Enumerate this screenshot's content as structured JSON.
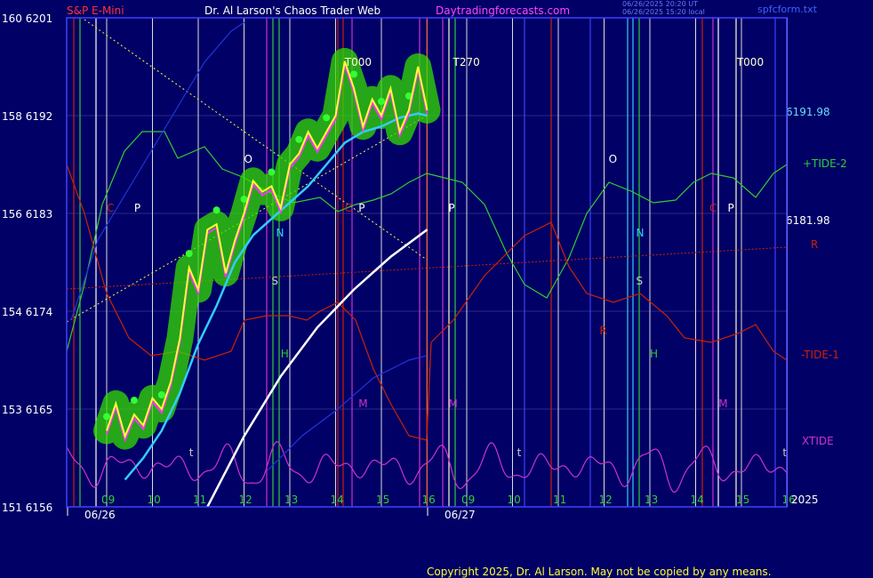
{
  "header": {
    "instrument": "S&P E-Mini",
    "site": "Dr. Al Larson's Chaos Trader Web",
    "url": "Daytradingforecasts.com",
    "stamp1": "06/26/2025 20:20 UT",
    "stamp2": "06/26/2025 15:20 local",
    "file": "spfcform.txt"
  },
  "copyright": "Copyright 2025, Dr. Al Larson. May not be copied by any means.",
  "year_label": "2025",
  "colors": {
    "background": "#000066",
    "frame": "#4040ff",
    "price": "#ffff33",
    "fast_avg": "#ff33ff",
    "moving_avg": "#33ccff",
    "long_avg": "#ffffff",
    "tide_plus2": "#33cc33",
    "tide_minus1": "#cc2200",
    "xtide": "#cc33cc",
    "glow": "#33dd00"
  },
  "chart_data": {
    "type": "line",
    "title": "S&P E-Mini",
    "left_axis_ticks": [
      {
        "label": "160  6201",
        "value": 6201
      },
      {
        "label": "158  6192",
        "value": 6192
      },
      {
        "label": "156  6183",
        "value": 6183
      },
      {
        "label": "154  6174",
        "value": 6174
      },
      {
        "label": "153  6165",
        "value": 6165
      },
      {
        "label": "151  6156",
        "value": 6156
      }
    ],
    "ylim": [
      6156,
      6201
    ],
    "hour_ticks_day1": [
      "09",
      "10",
      "11",
      "12",
      "13",
      "14",
      "15",
      "16"
    ],
    "hour_ticks_day2": [
      "09",
      "10",
      "11",
      "12",
      "13",
      "14",
      "15",
      "16"
    ],
    "dates": [
      "06/26",
      "06/27"
    ],
    "price_right_labels": [
      "6191.98",
      "6181.98"
    ],
    "series_labels": [
      "+TIDE-2",
      "R",
      "-TIDE-1",
      "XTIDE"
    ],
    "planet_markers": [
      {
        "label": "C",
        "hour": 9.0,
        "row": "upper",
        "color": "#cc2200"
      },
      {
        "label": "P",
        "hour": 9.6,
        "row": "upper",
        "color": "#ffffff"
      },
      {
        "label": "O",
        "hour": 12.0,
        "row": "o",
        "color": "#ffffff"
      },
      {
        "label": "N",
        "hour": 12.7,
        "row": "n",
        "color": "#33ccff"
      },
      {
        "label": "S",
        "hour": 12.6,
        "row": "s",
        "color": "#cccccc"
      },
      {
        "label": "H",
        "hour": 12.8,
        "row": "h",
        "color": "#33cc33"
      },
      {
        "label": "C",
        "hour": 14.2,
        "row": "upper",
        "color": "#cc2200"
      },
      {
        "label": "P",
        "hour": 14.5,
        "row": "upper",
        "color": "#ffffff"
      },
      {
        "label": "M",
        "hour": 14.5,
        "row": "m",
        "color": "#cc33cc"
      },
      {
        "label": "T000",
        "hour": 14.2,
        "row": "top",
        "color": "#ffffcc"
      },
      {
        "label": "P",
        "hour": 16.6,
        "row": "upper",
        "color": "#ffffff"
      },
      {
        "label": "M",
        "hour": 16.6,
        "row": "m",
        "color": "#cc33cc"
      },
      {
        "label": "T270",
        "hour": 16.7,
        "row": "top",
        "color": "#ffffcc"
      },
      {
        "label": "O",
        "hour": 20.1,
        "row": "o",
        "color": "#ffffff"
      },
      {
        "label": "N",
        "hour": 20.7,
        "row": "n",
        "color": "#33ccff"
      },
      {
        "label": "S",
        "hour": 20.7,
        "row": "s",
        "color": "#cccccc"
      },
      {
        "label": "H",
        "hour": 21.0,
        "row": "h",
        "color": "#33cc33"
      },
      {
        "label": "R",
        "hour": 19.9,
        "row": "r",
        "color": "#cc2200"
      },
      {
        "label": "C",
        "hour": 22.3,
        "row": "upper",
        "color": "#cc2200"
      },
      {
        "label": "P",
        "hour": 22.7,
        "row": "upper",
        "color": "#ffffff"
      },
      {
        "label": "M",
        "hour": 22.5,
        "row": "m",
        "color": "#cc33cc"
      },
      {
        "label": "T000",
        "hour": 22.9,
        "row": "top",
        "color": "#ffffcc"
      },
      {
        "label": "t",
        "hour": 10.8,
        "row": "t",
        "color": "#cccccc"
      },
      {
        "label": "t",
        "hour": 18.1,
        "row": "t",
        "color": "#cccccc"
      },
      {
        "label": "t",
        "hour": 23.9,
        "row": "t",
        "color": "#cccccc"
      }
    ],
    "price_series": {
      "hours": [
        9.0,
        9.2,
        9.4,
        9.6,
        9.8,
        10.0,
        10.2,
        10.4,
        10.6,
        10.8,
        11.0,
        11.2,
        11.4,
        11.6,
        11.8,
        12.0,
        12.2,
        12.4,
        12.6,
        12.8,
        13.0,
        13.2,
        13.4,
        13.6,
        13.8,
        14.0,
        14.2,
        14.4,
        14.6,
        14.8,
        15.0,
        15.2,
        15.4,
        15.6,
        15.8,
        16.0
      ],
      "values": [
        6163.0,
        6165.5,
        6162.5,
        6164.5,
        6163.5,
        6166.0,
        6165.0,
        6167.5,
        6171.5,
        6178.0,
        6176.0,
        6181.5,
        6182.0,
        6177.5,
        6180.5,
        6183.0,
        6186.0,
        6185.0,
        6185.5,
        6183.5,
        6187.5,
        6188.5,
        6190.5,
        6189.0,
        6190.5,
        6192.0,
        6197.0,
        6194.5,
        6191.0,
        6193.5,
        6192.0,
        6194.5,
        6190.5,
        6192.5,
        6196.5,
        6192.5
      ]
    },
    "moving_average": {
      "hours": [
        9.4,
        9.8,
        10.2,
        10.6,
        11.0,
        11.4,
        11.8,
        12.2,
        12.6,
        13.0,
        13.4,
        13.8,
        14.2,
        14.6,
        15.0,
        15.4,
        15.8,
        16.0
      ],
      "values": [
        6158.5,
        6160.5,
        6163.0,
        6166.5,
        6171.0,
        6174.5,
        6178.5,
        6181.0,
        6182.5,
        6184.0,
        6185.5,
        6187.5,
        6189.5,
        6190.5,
        6191.0,
        6191.8,
        6192.2,
        6192.0
      ]
    },
    "long_average": {
      "hours": [
        11.2,
        12.0,
        12.8,
        13.6,
        14.4,
        15.2,
        16.0
      ],
      "values": [
        6156.0,
        6162.5,
        6168.0,
        6172.5,
        6176.0,
        6179.0,
        6181.5
      ]
    }
  }
}
